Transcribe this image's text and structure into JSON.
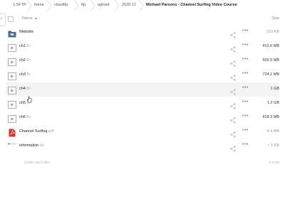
{
  "breadcrumb": [
    "1.SFTP",
    "home",
    "cloudftp",
    "ftp",
    "upload",
    "2020-11",
    "Michael Parsons - Channel Surfing Video Course"
  ],
  "header": {
    "name_label": "Name",
    "sort_indicator": "▲",
    "size_label": "Size"
  },
  "files": [
    {
      "name": "Website",
      "ext": "",
      "type": "folder-icon",
      "size": "212 KB",
      "size_style": "light"
    },
    {
      "name": "ch1",
      "ext": ".flv",
      "type": "video-file-icon",
      "size": "412.6 MB",
      "size_style": ""
    },
    {
      "name": "ch2",
      "ext": ".flv",
      "type": "video-file-icon",
      "size": "505.5 MB",
      "size_style": ""
    },
    {
      "name": "ch3",
      "ext": ".flv",
      "type": "video-file-icon",
      "size": "724.1 MB",
      "size_style": ""
    },
    {
      "name": "ch4",
      "ext": ".flv",
      "type": "video-file-icon",
      "size": "1 GB",
      "size_style": ""
    },
    {
      "name": "ch5",
      "ext": ".flv",
      "type": "video-file-icon",
      "size": "1.2 GB",
      "size_style": ""
    },
    {
      "name": "ch6",
      "ext": ".flv",
      "type": "video-file-icon",
      "size": "418.3 MB",
      "size_style": ""
    },
    {
      "name": "Channel Surfing",
      "ext": ".pdf",
      "type": "pdf-file-icon",
      "size": "4.4 MB",
      "size_style": "light"
    },
    {
      "name": "information",
      "ext": ".txt",
      "type": "text-file-icon",
      "size": "< 1 KB",
      "size_style": "light"
    }
  ],
  "summary": {
    "text": "1 folder and 8 files",
    "total": "4.2 GB"
  },
  "colors": {
    "folder": "#4a6a8a",
    "pdf": "#d9302b",
    "icon_gray": "#9a9a9a"
  }
}
